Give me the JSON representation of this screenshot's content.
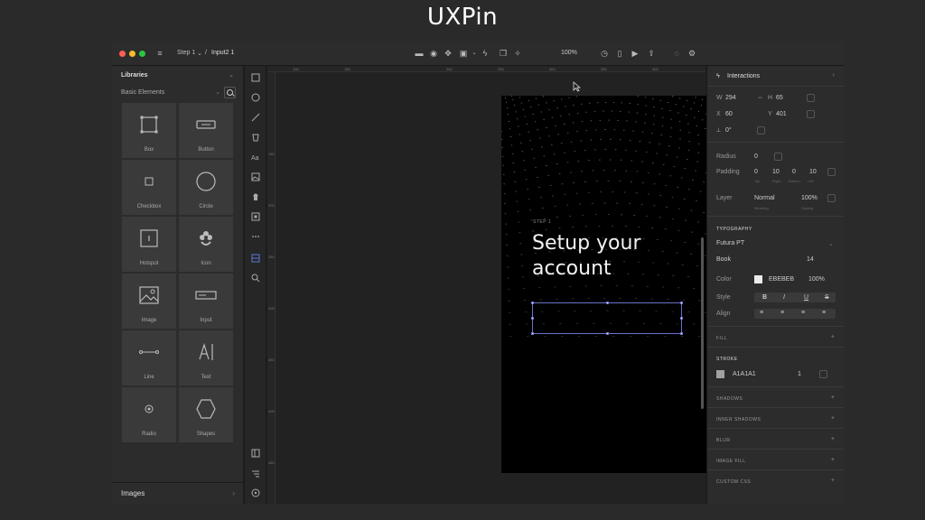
{
  "video_title": "UXPin",
  "topbar": {
    "breadcrumb_step": "Step 1",
    "breadcrumb_sep": "/",
    "breadcrumb_element": "Input2 1",
    "zoom": "100%"
  },
  "library": {
    "title": "Libraries",
    "selected_library": "Basic Elements",
    "tiles": [
      {
        "label": "Box",
        "icon": "box-icon"
      },
      {
        "label": "Button",
        "icon": "button-icon"
      },
      {
        "label": "Checkbox",
        "icon": "checkbox-icon"
      },
      {
        "label": "Circle",
        "icon": "circle-icon"
      },
      {
        "label": "Hotspot",
        "icon": "hotspot-icon"
      },
      {
        "label": "Icon",
        "icon": "flower-icon"
      },
      {
        "label": "Image",
        "icon": "image-icon"
      },
      {
        "label": "Input",
        "icon": "input-icon"
      },
      {
        "label": "Line",
        "icon": "line-icon"
      },
      {
        "label": "Text",
        "icon": "text-icon"
      },
      {
        "label": "Radio",
        "icon": "radio-icon"
      },
      {
        "label": "Shapes",
        "icon": "hexagon-icon"
      }
    ],
    "footer_label": "Images"
  },
  "rulers": {
    "top": [
      "100",
      "150",
      "200",
      "250",
      "300",
      "350",
      "400"
    ],
    "left": [
      "150",
      "200",
      "250",
      "300",
      "350",
      "400",
      "450"
    ]
  },
  "artboard": {
    "step_label": "STEP 1",
    "heading_line1": "Setup your",
    "heading_line2": "account"
  },
  "properties": {
    "interactions_label": "Interactions",
    "w_label": "W",
    "w_value": "294",
    "h_label": "H",
    "h_value": "65",
    "x_label": "X",
    "x_value": "60",
    "y_label": "Y",
    "y_value": "401",
    "rotation": "0°",
    "radius_label": "Radius",
    "radius_value": "0",
    "padding_label": "Padding",
    "padding_values": [
      "0",
      "10",
      "0",
      "10"
    ],
    "padding_sub": [
      "Top",
      "Right",
      "Bottom",
      "Left"
    ],
    "layer_label": "Layer",
    "layer_blend": "Normal",
    "layer_opacity": "100%",
    "layer_blend_sub": "Blending",
    "layer_opacity_sub": "Opacity",
    "typography_label": "TYPOGRAPHY",
    "font_family": "Futura PT",
    "font_weight": "Book",
    "font_size": "14",
    "color_label": "Color",
    "color_hex": "EBEBEB",
    "color_opacity": "100%",
    "style_label": "Style",
    "style_buttons": [
      "B",
      "I",
      "U",
      "S"
    ],
    "align_label": "Align",
    "fill_label": "FILL",
    "stroke_label": "STROKE",
    "stroke_hex": "A1A1A1",
    "stroke_width": "1",
    "sections": [
      "SHADOWS",
      "INNER SHADOWS",
      "BLUR",
      "IMAGE FILL",
      "CUSTOM CSS"
    ],
    "colors": {
      "text_swatch": "#ebebeb",
      "stroke_swatch": "#a1a1a1",
      "selection": "#6a72c9"
    }
  }
}
